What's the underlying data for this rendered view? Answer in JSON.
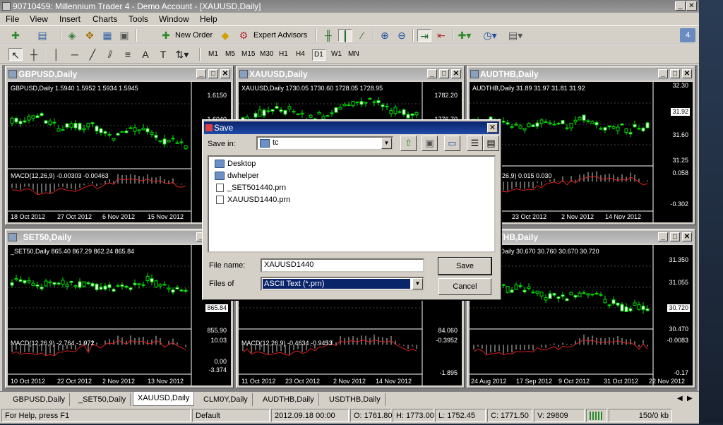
{
  "window": {
    "title": "90710459: Millennium Trader 4 - Demo Account - [XAUUSD,Daily]"
  },
  "menu": [
    "File",
    "View",
    "Insert",
    "Charts",
    "Tools",
    "Window",
    "Help"
  ],
  "toolbar": {
    "new_order": "New Order",
    "expert_advisors": "Expert Advisors",
    "notifications_count": "4",
    "timeframes": [
      "M1",
      "M5",
      "M15",
      "M30",
      "H1",
      "H4",
      "D1",
      "W1",
      "MN"
    ],
    "active_timeframe": "D1"
  },
  "charts": [
    {
      "id": "gbpusd",
      "title": "GBPUSD,Daily",
      "info": "GBPUSD,Daily  1.5940  1.5952  1.5934  1.5945",
      "prices": [
        "1.6150",
        "1.6040"
      ],
      "macd": "MACD(12,26,9) -0.00303 -0.00463",
      "dates": [
        "18 Oct 2012",
        "27 Oct 2012",
        "6 Nov 2012",
        "15 Nov 2012"
      ]
    },
    {
      "id": "xauusd",
      "title": "XAUUSD,Daily",
      "info": "XAUUSD,Daily  1730.05 1730.60 1728.05 1728.95",
      "prices": [
        "1782.20",
        "1776.70"
      ],
      "macd": "",
      "dates": []
    },
    {
      "id": "audthb",
      "title": "AUDTHB,Daily",
      "info": "AUDTHB,Daily  31.89 31.97 31.81 31.92",
      "prices": [
        "32.30",
        "31.92",
        "31.60",
        "31.25",
        "0.058",
        "-0.302"
      ],
      "macd": "MACD(12,26,9) 0.015 0.030",
      "dates": [
        "23 Oct 2012",
        "2 Nov 2012",
        "14 Nov 2012"
      ]
    },
    {
      "id": "set50",
      "title": "_SET50,Daily",
      "info": "_SET50,Daily  865.40 867.29 862.24 865.84",
      "prices": [
        "865.84",
        "855.90",
        "10.03",
        "0.00",
        "-3.374"
      ],
      "macd": "MACD(12,26,9) -2.764 -1.972",
      "dates": [
        "10 Oct 2012",
        "22 Oct 2012",
        "2 Nov 2012",
        "13 Nov 2012"
      ]
    },
    {
      "id": "xauusd2",
      "title": "",
      "info": "",
      "prices": [
        "84.060",
        "-0.3952",
        "-1.895"
      ],
      "macd": "MACD(12,26,9) -0.4634 -0.9453",
      "dates": [
        "11 Oct 2012",
        "23 Oct 2012",
        "2 Nov 2012",
        "14 Nov 2012"
      ]
    },
    {
      "id": "usdthb",
      "title": "USDTHB,Daily",
      "info": "USDTHB,Daily  30.670 30.760 30.670 30.720",
      "prices": [
        "31.350",
        "31.055",
        "30.720",
        "30.470",
        "-0.0083",
        "-0.17"
      ],
      "macd": "",
      "dates": [
        "24 Aug 2012",
        "17 Sep 2012",
        "9 Oct 2012",
        "31 Oct 2012",
        "22 Nov 2012"
      ]
    }
  ],
  "tabs": [
    "GBPUSD,Daily",
    "_SET50,Daily",
    "XAUUSD,Daily",
    "CLM0Y,Daily",
    "AUDTHB,Daily",
    "USDTHB,Daily"
  ],
  "active_tab": "XAUUSD,Daily",
  "status": {
    "help": "For Help, press F1",
    "profile": "Default",
    "time": "2012.09.18 00:00",
    "open": "O: 1761.80",
    "high": "H: 1773.00",
    "low": "L: 1752.45",
    "close": "C: 1771.50",
    "volume": "V: 29809",
    "traffic": "150/0 kb"
  },
  "dialog": {
    "title": "Save",
    "save_in_label": "Save in:",
    "save_in_value": "tc",
    "files": [
      {
        "name": "Desktop",
        "type": "folder"
      },
      {
        "name": "dwhelper",
        "type": "folder"
      },
      {
        "name": "_SET501440.prn",
        "type": "file"
      },
      {
        "name": "XAUUSD1440.prn",
        "type": "file"
      }
    ],
    "file_name_label": "File name:",
    "file_name_value": "XAUUSD1440",
    "files_of_label": "Files of",
    "files_of_value": "ASCII Text (*.prn)",
    "save_button": "Save",
    "cancel_button": "Cancel"
  }
}
